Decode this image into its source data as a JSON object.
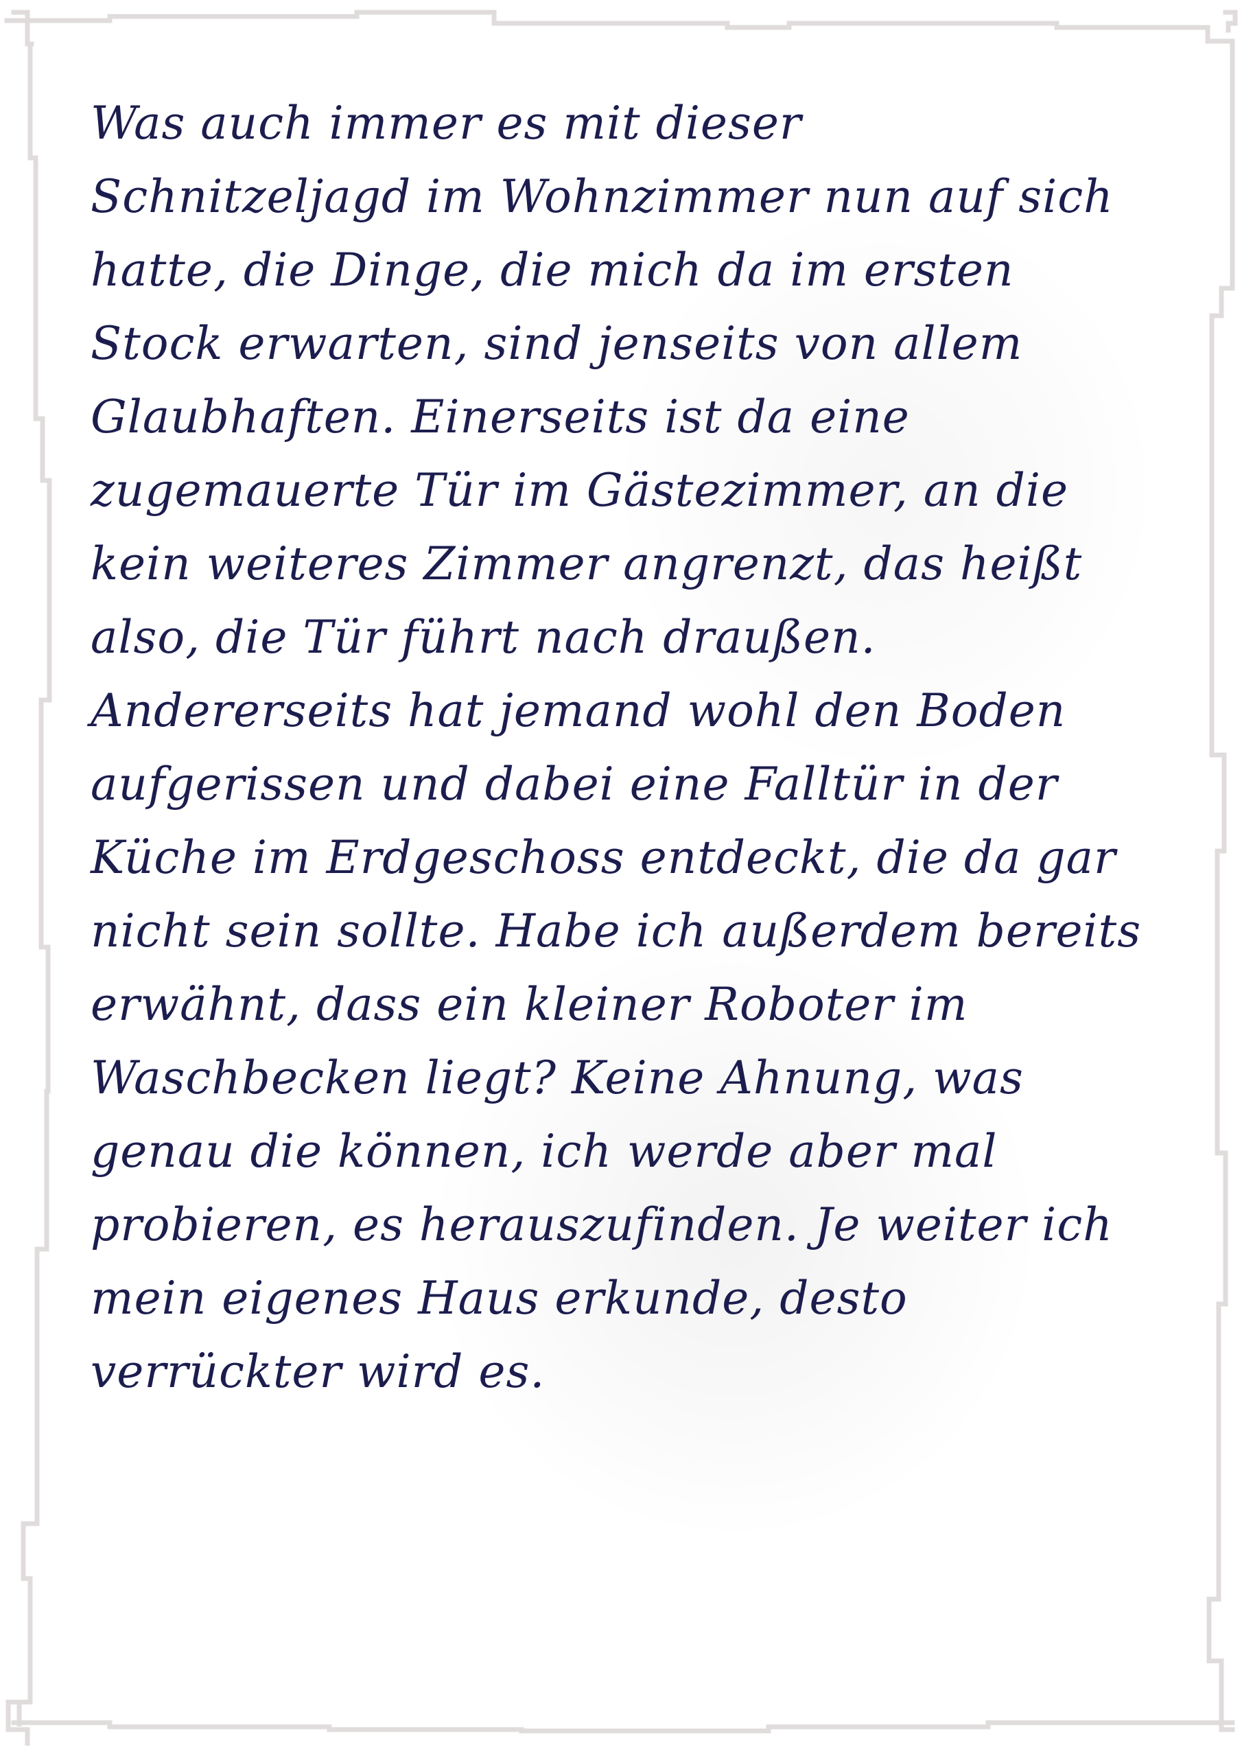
{
  "note": {
    "lines": [
      "Was auch immer es mit dieser",
      "Schnitzeljagd im Wohnzimmer nun auf sich",
      "hatte, die Dinge, die mich da im ersten",
      "Stock erwarten, sind jenseits von allem",
      "Glaubhaften. Einerseits ist da eine",
      "zugemauerte Tür im Gästezimmer, an die",
      "kein weiteres Zimmer angrenzt, das heißt",
      "also, die Tür führt nach draußen.",
      "Andererseits hat jemand wohl den Boden",
      "aufgerissen und dabei eine Falltür in der",
      "Küche im Erdgeschoss entdeckt, die da gar",
      "nicht sein sollte. Habe ich außerdem bereits",
      "erwähnt, dass ein kleiner Roboter im",
      "Waschbecken liegt? Keine Ahnung, was",
      "genau die können, ich werde aber mal",
      "probieren, es herauszufinden. Je weiter ich",
      "mein eigenes Haus erkunde, desto",
      "verrückter wird es."
    ],
    "text_color": "#1c1d4e",
    "border_color": "#e0dcdc"
  }
}
